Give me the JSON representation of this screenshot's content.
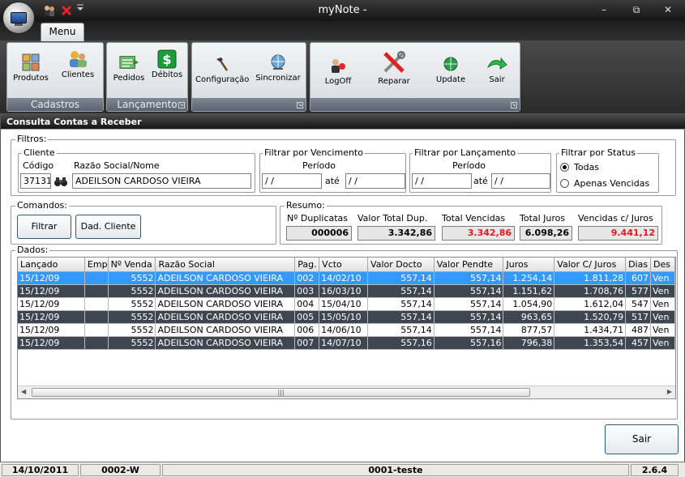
{
  "app": {
    "title": "myNote -",
    "window_controls": {
      "minimize": "–",
      "restore": "⧉",
      "close": "✕"
    }
  },
  "ribbon": {
    "tab": "Menu",
    "groups": [
      {
        "label": "Cadastros",
        "buttons": [
          "Produtos",
          "Clientes"
        ]
      },
      {
        "label": "Lançamento",
        "buttons": [
          "Pedidos",
          "Débitos"
        ]
      },
      {
        "label": "",
        "buttons": [
          "Configuração",
          "Sincronizar"
        ]
      },
      {
        "label": "",
        "buttons": [
          "LogOff",
          "Reparar",
          "Update",
          "Sair"
        ]
      }
    ]
  },
  "form": {
    "title": "Consulta Contas a Receber",
    "filtros": {
      "legend": "Filtros:",
      "cliente": {
        "legend": "Cliente",
        "codigo_label": "Código",
        "codigo_value": "37131",
        "razao_label": "Razão Social/Nome",
        "razao_value": "ADEILSON CARDOSO VIEIRA"
      },
      "vencimento": {
        "legend": "Filtrar por Vencimento",
        "periodo": "Período",
        "de": " / /",
        "ate_label": "até",
        "ate": " / /"
      },
      "lancamento": {
        "legend": "Filtrar por Lançamento",
        "periodo": "Período",
        "de": " / /",
        "ate_label": "até",
        "ate": " / /"
      },
      "status": {
        "legend": "Filtrar por Status",
        "options": [
          "Todas",
          "Apenas Vencidas"
        ],
        "selected": "Todas"
      }
    },
    "comandos": {
      "legend": "Comandos:",
      "filtrar": "Filtrar",
      "dad_cliente": "Dad. Cliente"
    },
    "resumo": {
      "legend": "Resumo:",
      "labels": [
        "Nº Duplicatas",
        "Valor Total Dup.",
        "Total Vencidas",
        "Total Juros",
        "Vencidas c/ Juros"
      ],
      "values": [
        "000006",
        "3.342,86",
        "3.342,86",
        "6.098,26",
        "9.441,12"
      ],
      "red_color": "#e8181c"
    },
    "dados": {
      "legend": "Dados:",
      "columns": [
        "Lançado",
        "Emp",
        "Nº Venda",
        "Razão Social",
        "Pag.",
        "Vcto",
        "Valor Docto",
        "Valor Pendte",
        "Juros",
        "Valor C/ Juros",
        "Dias",
        "Des"
      ],
      "rows": [
        [
          "15/12/09",
          "",
          "5552",
          "ADEILSON CARDOSO VIEIRA",
          "002",
          "14/02/10",
          "557,14",
          "557,14",
          "1.254,14",
          "1.811,28",
          "607",
          "Ven"
        ],
        [
          "15/12/09",
          "",
          "5552",
          "ADEILSON CARDOSO VIEIRA",
          "003",
          "16/03/10",
          "557,14",
          "557,14",
          "1.151,62",
          "1.708,76",
          "577",
          "Ven"
        ],
        [
          "15/12/09",
          "",
          "5552",
          "ADEILSON CARDOSO VIEIRA",
          "004",
          "15/04/10",
          "557,14",
          "557,14",
          "1.054,90",
          "1.612,04",
          "547",
          "Ven"
        ],
        [
          "15/12/09",
          "",
          "5552",
          "ADEILSON CARDOSO VIEIRA",
          "005",
          "15/05/10",
          "557,14",
          "557,14",
          "963,65",
          "1.520,79",
          "517",
          "Ven"
        ],
        [
          "15/12/09",
          "",
          "5552",
          "ADEILSON CARDOSO VIEIRA",
          "006",
          "14/06/10",
          "557,14",
          "557,14",
          "877,57",
          "1.434,71",
          "487",
          "Ven"
        ],
        [
          "15/12/09",
          "",
          "5552",
          "ADEILSON CARDOSO VIEIRA",
          "007",
          "14/07/10",
          "557,16",
          "557,16",
          "796,38",
          "1.353,54",
          "457",
          "Ven"
        ]
      ],
      "row_styles": [
        "sel",
        "dark",
        "light",
        "dark",
        "light",
        "dark"
      ]
    },
    "sair": "Sair"
  },
  "status_bar": [
    "14/10/2011",
    "0002-W",
    "0001-teste",
    "2.6.4"
  ]
}
